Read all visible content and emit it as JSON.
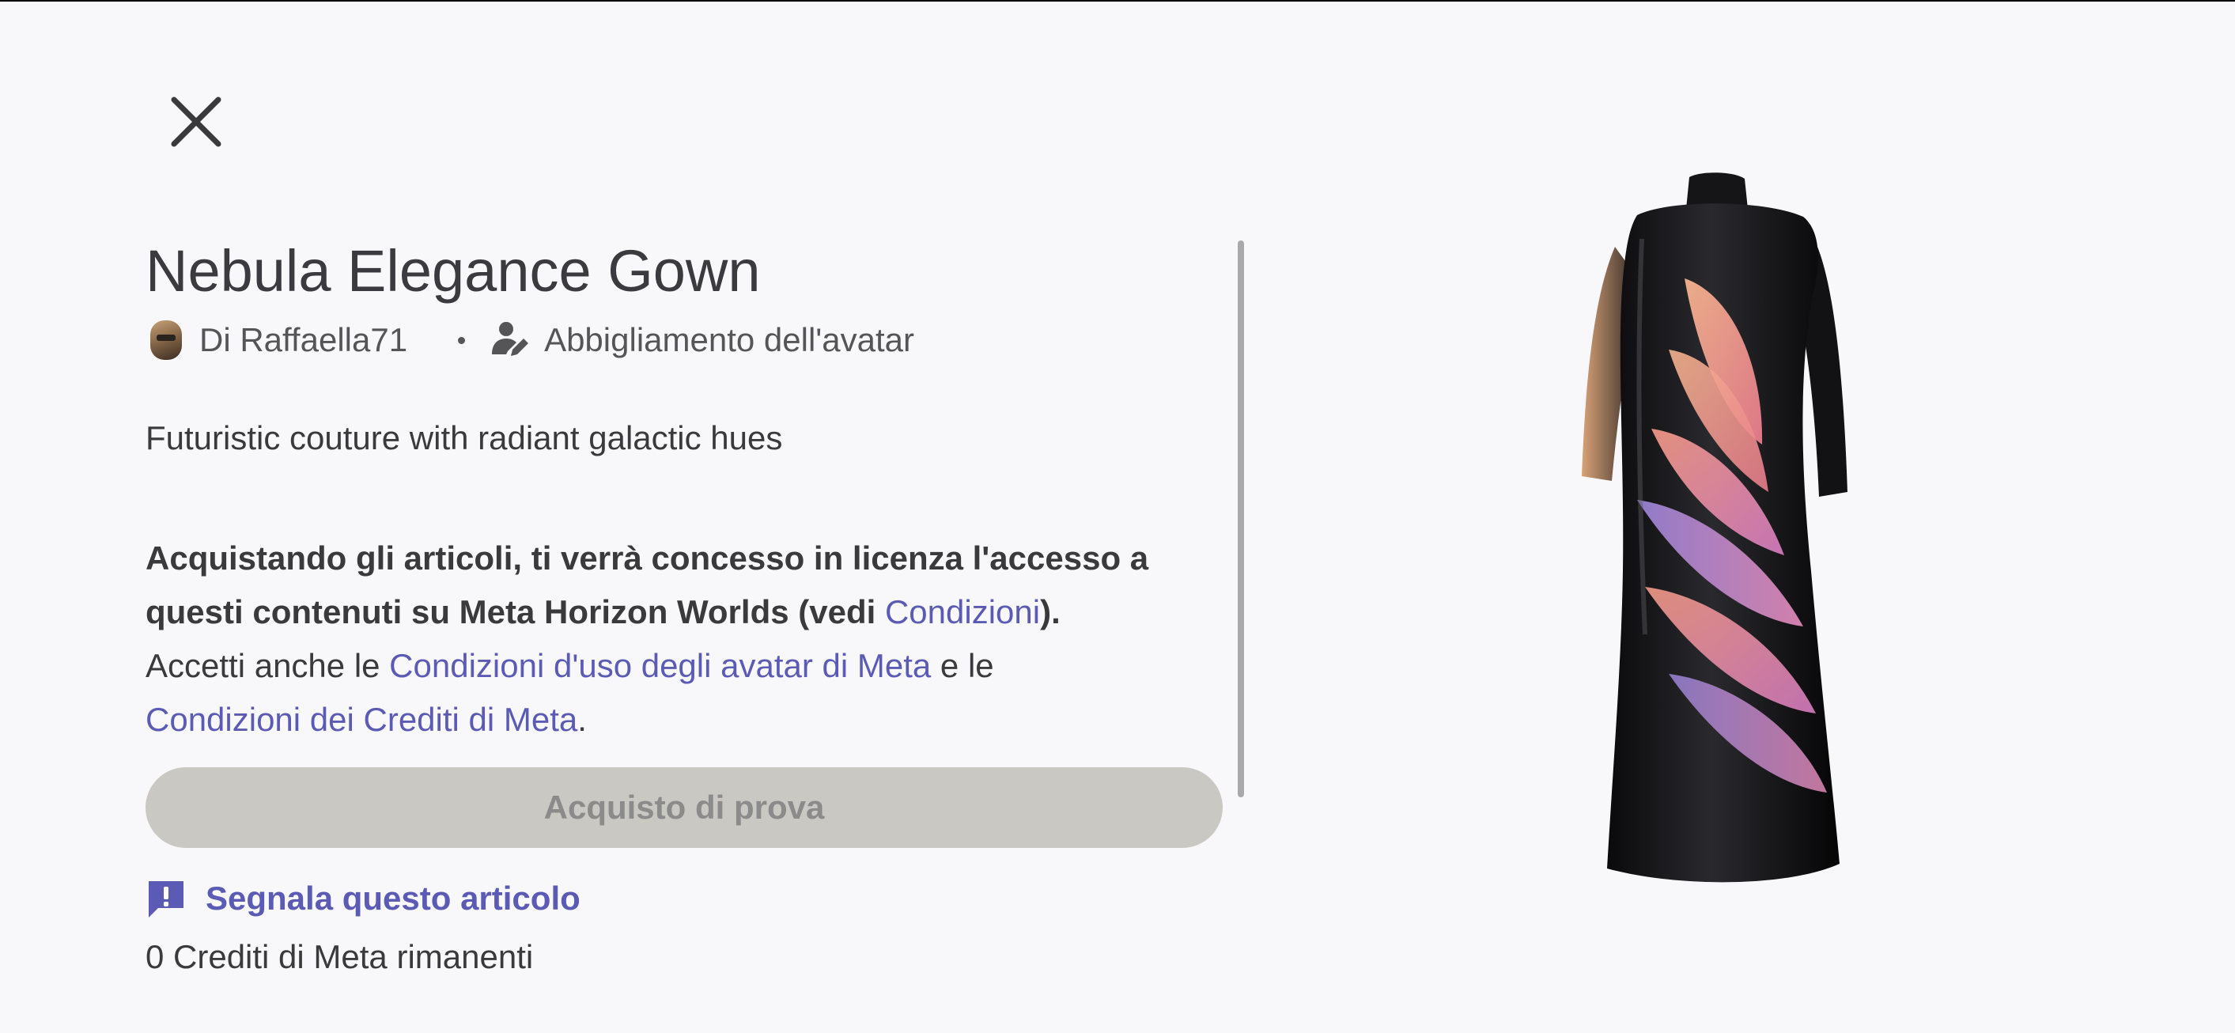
{
  "item": {
    "title": "Nebula Elegance Gown",
    "creator": "Di Raffaella71",
    "category": "Abbigliamento dell'avatar",
    "description": "Futuristic couture with radiant galactic hues"
  },
  "legal": {
    "bold_line": "Acquistando gli articoli, ti verrà concesso in licenza l'accesso a questi contenuti su Meta Horizon Worlds (vedi ",
    "terms_link": "Condizioni",
    "bold_end": ").",
    "accept_prefix": "Accetti anche le ",
    "avatar_terms_link": "Condizioni d'uso degli avatar di Meta",
    "accept_mid": " e le ",
    "credits_terms_link": "Condizioni dei Crediti di Meta",
    "accept_end": "."
  },
  "actions": {
    "buy_label": "Acquisto di prova",
    "report_label": "Segnala questo articolo"
  },
  "credits_text": "0 Crediti di Meta rimanenti",
  "icons": {
    "close": "close-icon",
    "category": "person-edit-icon",
    "report": "report-flag-icon"
  },
  "colors": {
    "accent": "#5b5bb5",
    "disabled_button": "#c9c8c2",
    "background": "#f8f8fb"
  }
}
